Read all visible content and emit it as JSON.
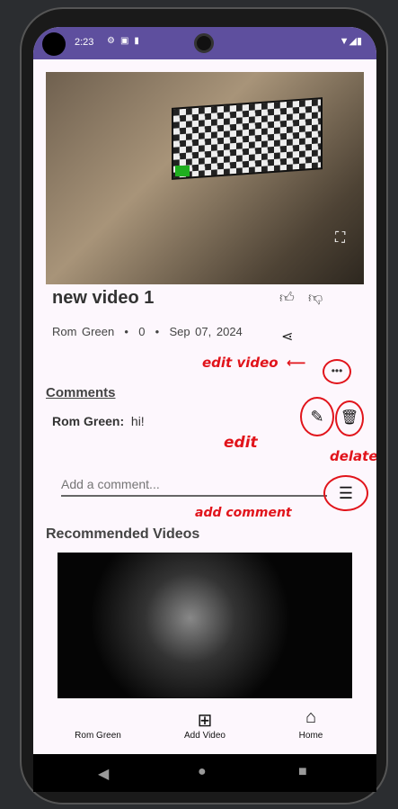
{
  "status_bar": {
    "time": "2:23",
    "left_icons": [
      "gear-icon",
      "a-icon",
      "sd-card-icon"
    ],
    "right_icons": [
      "wifi-icon",
      "signal-icon",
      "battery-icon"
    ]
  },
  "video": {
    "title": "new video 1",
    "author": "Rom Green",
    "views": "0",
    "date": "Sep 07, 2024"
  },
  "comments": {
    "heading": "Comments",
    "items": [
      {
        "author": "Rom Green:",
        "text": "hi!"
      }
    ],
    "placeholder": "Add a comment..."
  },
  "recommended": {
    "heading": "Recommended Videos"
  },
  "bottom_nav": {
    "items": [
      {
        "label": "Rom Green"
      },
      {
        "label": "Add Video"
      },
      {
        "label": "Home"
      }
    ]
  },
  "annotations": {
    "edit_video": "edit video",
    "edit": "edit",
    "delete": "delate",
    "add_comment": "add comment"
  },
  "colors": {
    "status_bar": "#5e4f9e",
    "annotation": "#e1141b",
    "background": "#fdf7fd"
  }
}
